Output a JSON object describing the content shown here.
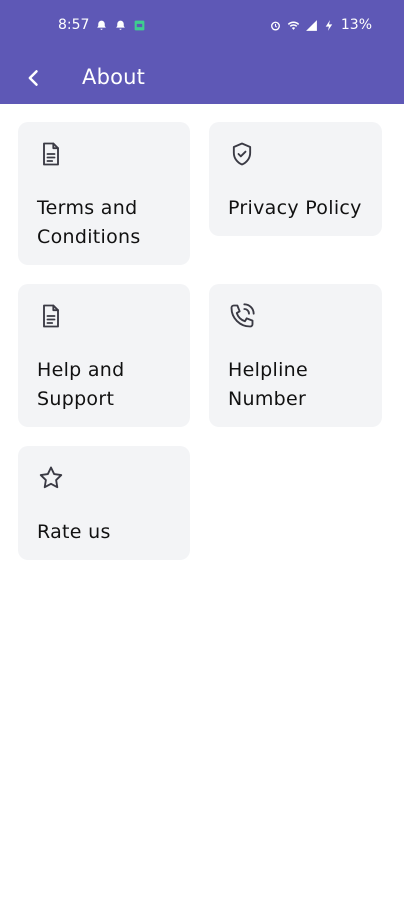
{
  "status_bar": {
    "time": "8:57",
    "battery": "13%",
    "left_icons": [
      "notification-bell-icon",
      "notification-bell-icon",
      "app-badge-icon"
    ],
    "right_icons": [
      "alarm-icon",
      "wifi-icon",
      "cell-signal-icon",
      "charging-icon"
    ]
  },
  "app_bar": {
    "title": "About",
    "back_icon": "back-arrow-icon",
    "background_color": "#5e58b6"
  },
  "cards": [
    {
      "label": "Terms and\nConditions",
      "icon": "document-icon"
    },
    {
      "label": "Privacy Policy",
      "icon": "shield-check-icon"
    },
    {
      "label": "Help and\nSupport",
      "icon": "document-icon"
    },
    {
      "label": "Helpline\nNumber",
      "icon": "phone-call-icon"
    },
    {
      "label": "Rate us",
      "icon": "star-icon"
    }
  ],
  "colors": {
    "card_background": "#f3f4f6",
    "text": "#111111",
    "accent": "#5e58b6"
  }
}
